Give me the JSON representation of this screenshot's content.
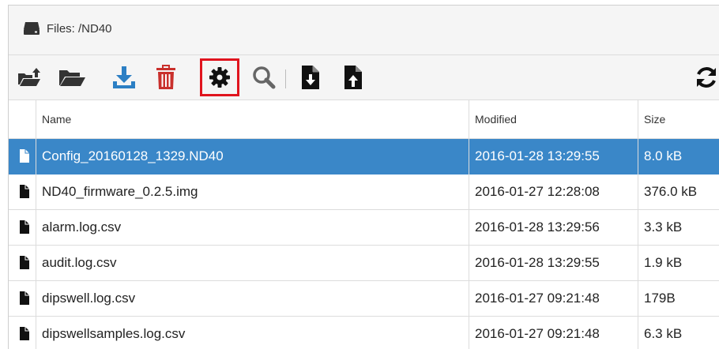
{
  "header": {
    "title": "Files: /ND40",
    "icon": "hard-drive-icon"
  },
  "toolbar": {
    "buttons": [
      {
        "name": "open-folder-up-icon"
      },
      {
        "name": "folder-open-icon"
      },
      {
        "name": "download-icon",
        "color": "#2c7fc4"
      },
      {
        "name": "trash-icon",
        "color": "#c9302c"
      },
      {
        "name": "gear-icon",
        "highlighted": true,
        "highlight_color": "#e0141e"
      },
      {
        "name": "search-icon"
      },
      {
        "name": "file-import-icon"
      },
      {
        "name": "file-export-icon"
      },
      {
        "name": "refresh-icon"
      }
    ]
  },
  "table": {
    "columns": [
      "Name",
      "Modified",
      "Size"
    ],
    "rows": [
      {
        "name": "Config_20160128_1329.ND40",
        "modified": "2016-01-28 13:29:55",
        "size": "8.0 kB",
        "selected": true
      },
      {
        "name": "ND40_firmware_0.2.5.img",
        "modified": "2016-01-27 12:28:08",
        "size": "376.0 kB"
      },
      {
        "name": "alarm.log.csv",
        "modified": "2016-01-28 13:29:56",
        "size": "3.3 kB"
      },
      {
        "name": "audit.log.csv",
        "modified": "2016-01-28 13:29:55",
        "size": "1.9 kB"
      },
      {
        "name": "dipswell.log.csv",
        "modified": "2016-01-27 09:21:48",
        "size": "179B"
      },
      {
        "name": "dipswellsamples.log.csv",
        "modified": "2016-01-27 09:21:48",
        "size": "6.3 kB"
      }
    ]
  },
  "colors": {
    "selection": "#3a87c8",
    "accent_blue": "#2c7fc4",
    "danger_red": "#c9302c"
  }
}
